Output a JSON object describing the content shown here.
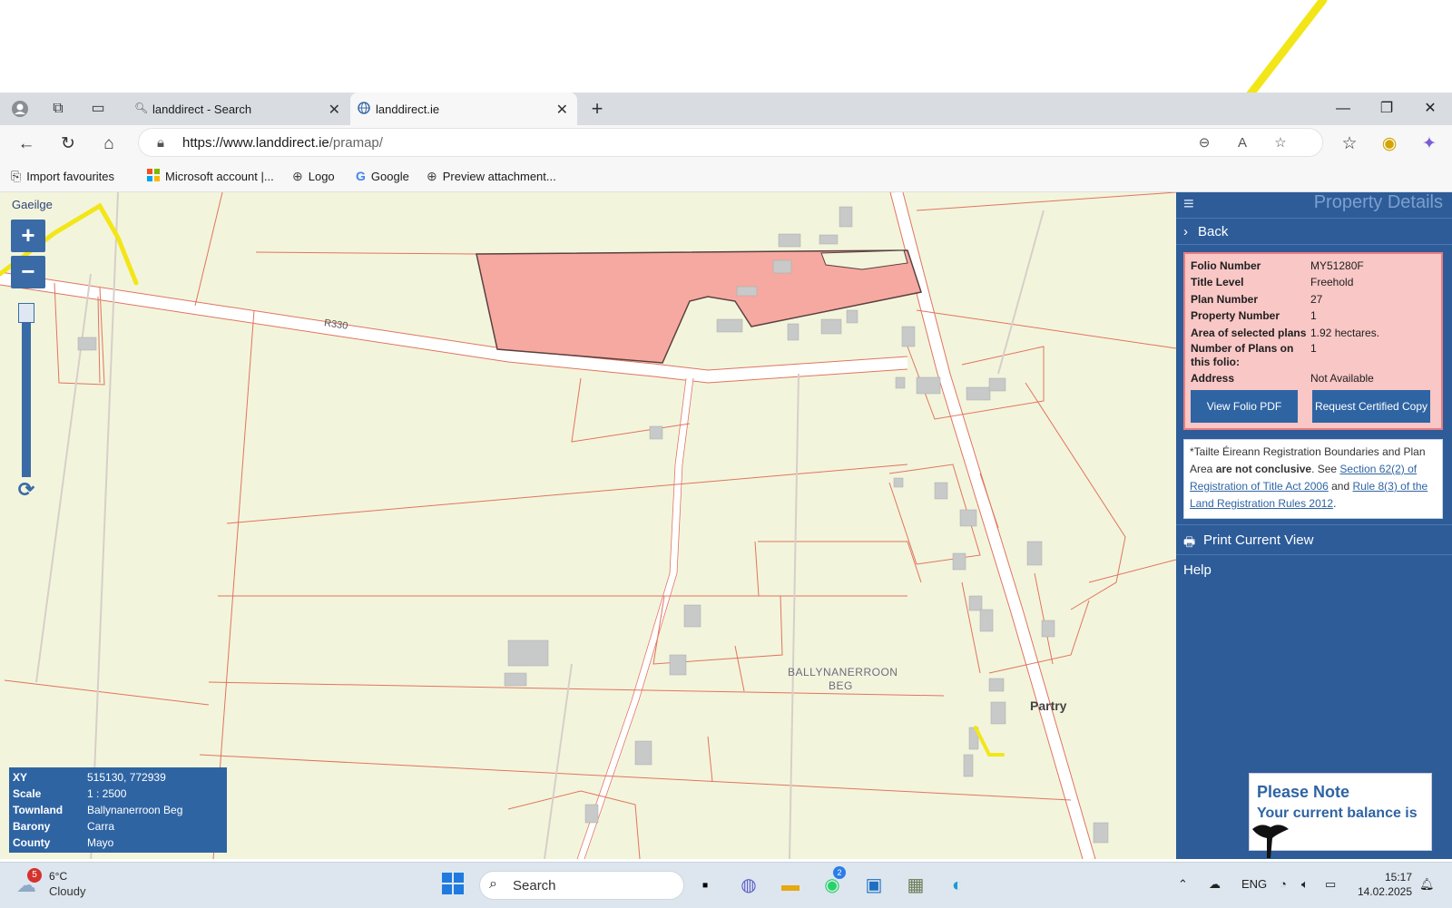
{
  "browser": {
    "tabs": [
      {
        "label": "landdirect - Search"
      },
      {
        "label": "landdirect.ie"
      }
    ],
    "url_prefix": "https://",
    "url_host": "www.landdirect.ie",
    "url_path": "/pramap/",
    "favourites": [
      {
        "label": "Import favourites"
      },
      {
        "label": "Microsoft account |..."
      },
      {
        "label": "Logo"
      },
      {
        "label": "Google"
      },
      {
        "label": "Preview attachment..."
      }
    ]
  },
  "map": {
    "language_link": "Gaeilge",
    "zoom_in": "+",
    "zoom_out": "−",
    "road_label": "R330",
    "townland_label_1": "BALLYNANERROON",
    "townland_label_2": "BEG",
    "village_label": "Partry",
    "info": {
      "xy_label": "XY",
      "xy_value": "515130, 772939",
      "scale_label": "Scale",
      "scale_value": "1 : 2500",
      "townland_label": "Townland",
      "townland_value": "Ballynanerroon Beg",
      "barony_label": "Barony",
      "barony_value": "Carra",
      "county_label": "County",
      "county_value": "Mayo"
    }
  },
  "panel": {
    "title": "Property Details",
    "back": "Back",
    "details": [
      {
        "k": "Folio Number",
        "v": "MY51280F"
      },
      {
        "k": "Title Level",
        "v": "Freehold"
      },
      {
        "k": "Plan Number",
        "v": "27"
      },
      {
        "k": "Property Number",
        "v": "1"
      },
      {
        "k": "Area of selected plans",
        "v": "1.92 hectares."
      },
      {
        "k": "Number of Plans on this folio:",
        "v": "1"
      },
      {
        "k": "Address",
        "v": "Not Available"
      }
    ],
    "view_pdf": "View Folio PDF",
    "request_copy": "Request Certified Copy",
    "disclaimer_1": "*Tailte Éireann Registration Boundaries and Plan Area ",
    "disclaimer_bold": "are not conclusive",
    "disclaimer_2": ". See ",
    "disclaimer_link1": "Section 62(2) of Registration of Title Act 2006",
    "disclaimer_3": " and ",
    "disclaimer_link2": "Rule 8(3) of the Land Registration Rules 2012",
    "disclaimer_4": ".",
    "print": "Print Current View",
    "help": "Help"
  },
  "note": {
    "title": "Please Note",
    "text": "Your current balance is"
  },
  "taskbar": {
    "weather_temp": "6°C",
    "weather_cond": "Cloudy",
    "weather_badge": "5",
    "search": "Search",
    "whatsapp_badge": "2",
    "lang": "ENG",
    "time": "15:17",
    "date": "14.02.2025"
  },
  "colors": {
    "panel_blue": "#2d5c99",
    "parcel_fill": "#f6a9a0",
    "boundary_red": "#e2735f",
    "map_bg": "#f2f5dc"
  }
}
